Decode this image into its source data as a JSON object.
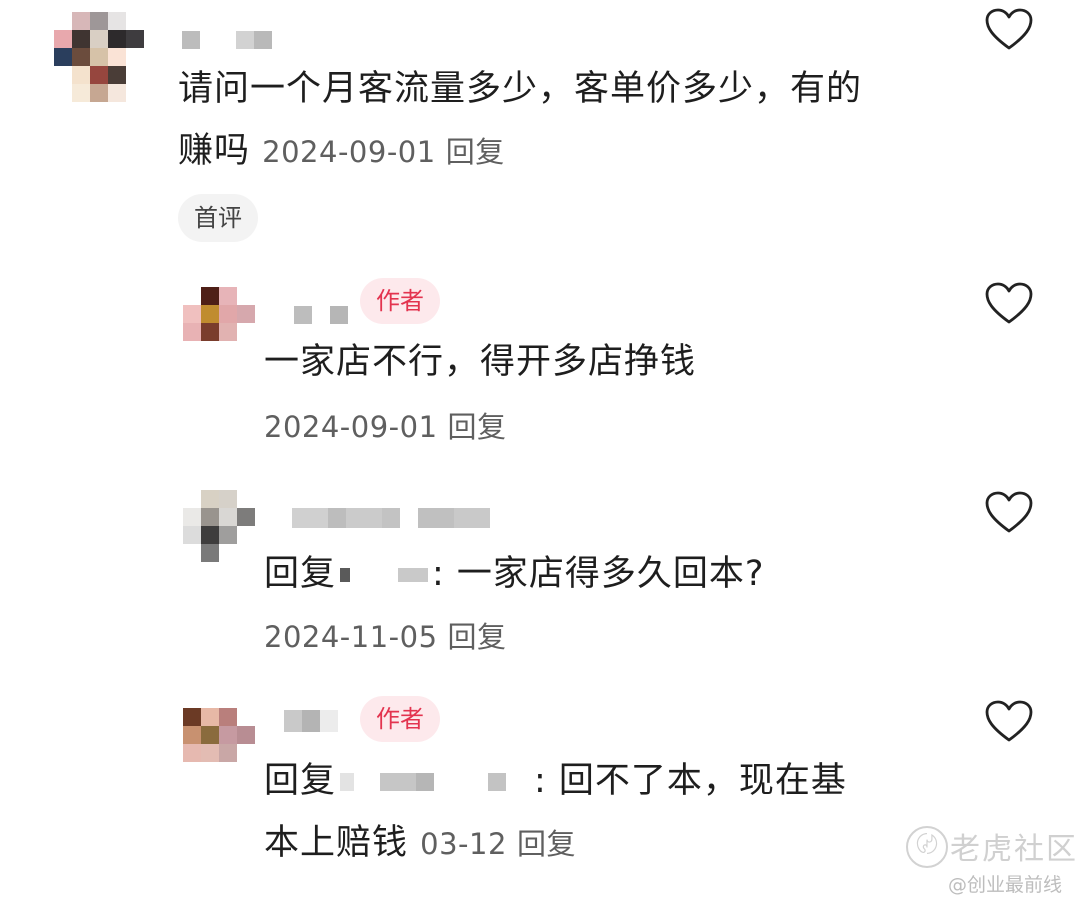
{
  "comments": [
    {
      "text_line1": "请问一个月客流量多少，客单价多少，有的",
      "text_line2": "赚吗",
      "date": "2024-09-01",
      "reply_label": "回复",
      "badge": "首评"
    },
    {
      "badge": "作者",
      "text": "一家店不行，得开多店挣钱",
      "date": "2024-09-01",
      "reply_label": "回复"
    },
    {
      "text_prefix": "回复",
      "text_suffix": ": 一家店得多久回本?",
      "date": "2024-11-05",
      "reply_label": "回复"
    },
    {
      "badge": "作者",
      "text_prefix": "回复",
      "text_suffix": ": 回不了本，现在基",
      "text_line2": "本上赔钱",
      "date": "03-12",
      "reply_label": "回复"
    }
  ],
  "icons": {
    "like": "heart-outline-icon",
    "watermark": "tiger-community-logo-icon"
  },
  "colors": {
    "author_badge_bg": "#fde9ec",
    "author_badge_text": "#e3344f",
    "meta_text": "#5f5f5f"
  },
  "watermark": {
    "brand": "老虎社区",
    "handle": "@创业最前线"
  }
}
